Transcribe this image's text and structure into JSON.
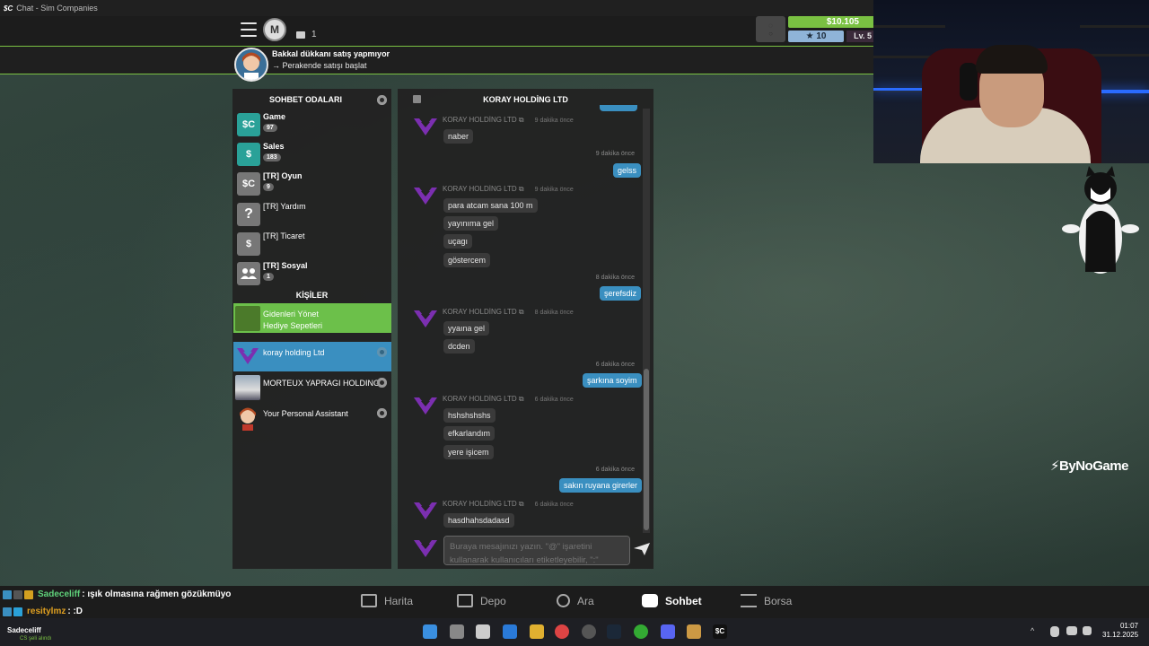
{
  "window": {
    "title": "Chat - Sim Companies",
    "app_logo": "$C"
  },
  "header": {
    "message_count": "1",
    "money": "$10.105",
    "rank": "10",
    "level": "Lv. 5"
  },
  "notification": {
    "title": "Bakkal dükkanı satış yapmıyor",
    "action": "→ Perakende satışı başlat"
  },
  "rooms": {
    "heading": "SOHBET ODALARI",
    "items": [
      {
        "name": "Game",
        "count": "97",
        "icon": "sim-companies-icon",
        "color": "#2aa198"
      },
      {
        "name": "Sales",
        "count": "183",
        "icon": "money-tag-icon",
        "color": "#2aa198"
      },
      {
        "name": "[TR] Oyun",
        "count": "9",
        "icon": "sim-companies-icon",
        "color": "#777777"
      },
      {
        "name": "[TR] Yardım",
        "count": "",
        "icon": "question-icon",
        "color": "#777777"
      },
      {
        "name": "[TR] Ticaret",
        "count": "",
        "icon": "money-tag-icon",
        "color": "#777777"
      },
      {
        "name": "[TR] Sosyal",
        "count": "1",
        "icon": "people-icon",
        "color": "#777777"
      }
    ]
  },
  "contacts": {
    "heading": "KİŞİLER",
    "items": [
      {
        "line1": "Gidenleri Yönet",
        "line2": "Hediye Sepetleri",
        "bg": "#6cc04a"
      },
      {
        "line1": "koray holding Ltd",
        "line2": "",
        "bg": "#3a8fc0"
      },
      {
        "line1": "MORTEUX YAPRAGI HOLDING",
        "line2": "",
        "bg": ""
      },
      {
        "line1": "Your Personal Assistant",
        "line2": "",
        "bg": ""
      }
    ]
  },
  "chat": {
    "title": "KORAY HOLDİNG LTD",
    "sender": "KORAY HOLDİNG LTD",
    "groups": [
      {
        "time": "9 dakika önce",
        "messages": [
          "naber"
        ]
      },
      {
        "time": "9 dakika önce",
        "messages": [
          "para atcam sana 100 m",
          "yayınıma gel",
          "uçagı",
          "göstercem"
        ]
      },
      {
        "time": "8 dakika önce",
        "messages": [
          "yyaına gel",
          "dcden"
        ]
      },
      {
        "time": "6 dakika önce",
        "messages": [
          "hshshshshs",
          "efkarlandım",
          "yere işicem"
        ]
      },
      {
        "time": "6 dakika önce",
        "messages": [
          "hasdhahsdadasd"
        ]
      }
    ],
    "outgoing": [
      {
        "time": "9 dakika önce",
        "text": "gelss"
      },
      {
        "time": "8 dakika önce",
        "text": "şerefsdiz"
      },
      {
        "time": "6 dakika önce",
        "text": "şarkına soyim"
      },
      {
        "time": "6 dakika önce",
        "text": "sakın ruyana girerler"
      }
    ],
    "input_placeholder": "Buraya mesajınızı yazın. \"@\" işaretini kullanarak kullanıcıları etiketleyebilir, \":\""
  },
  "nav": {
    "items": [
      {
        "label": "Harita",
        "icon": "map-icon"
      },
      {
        "label": "Depo",
        "icon": "warehouse-icon"
      },
      {
        "label": "Ara",
        "icon": "search-icon"
      },
      {
        "label": "Sohbet",
        "icon": "chat-icon"
      },
      {
        "label": "Borsa",
        "icon": "exchange-icon"
      }
    ]
  },
  "stream_chat": [
    {
      "user": "Sadeceliff",
      "text": " : ışık olmasına rağmen gözükmüyo"
    },
    {
      "user": "resitylmz",
      "text": " : :D"
    }
  ],
  "stream": {
    "brand": "ByNoGame",
    "streamer": "Sadeceliff",
    "streamer_sub": "CS şeli alındı"
  },
  "taskbar": {
    "time": "01:07",
    "date": "31.12.2025"
  }
}
